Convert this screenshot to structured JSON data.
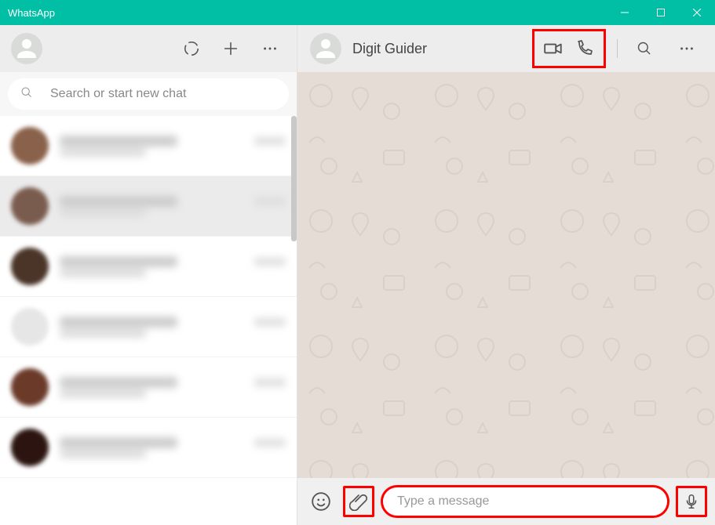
{
  "window": {
    "title": "WhatsApp"
  },
  "sidebar": {
    "search_placeholder": "Search or start new chat",
    "chat_items": [
      {},
      {},
      {},
      {},
      {},
      {}
    ]
  },
  "conversation": {
    "contact_name": "Digit Guider"
  },
  "composer": {
    "input_placeholder": "Type a message"
  },
  "annotations": {
    "highlight_color": "#ff0000"
  }
}
